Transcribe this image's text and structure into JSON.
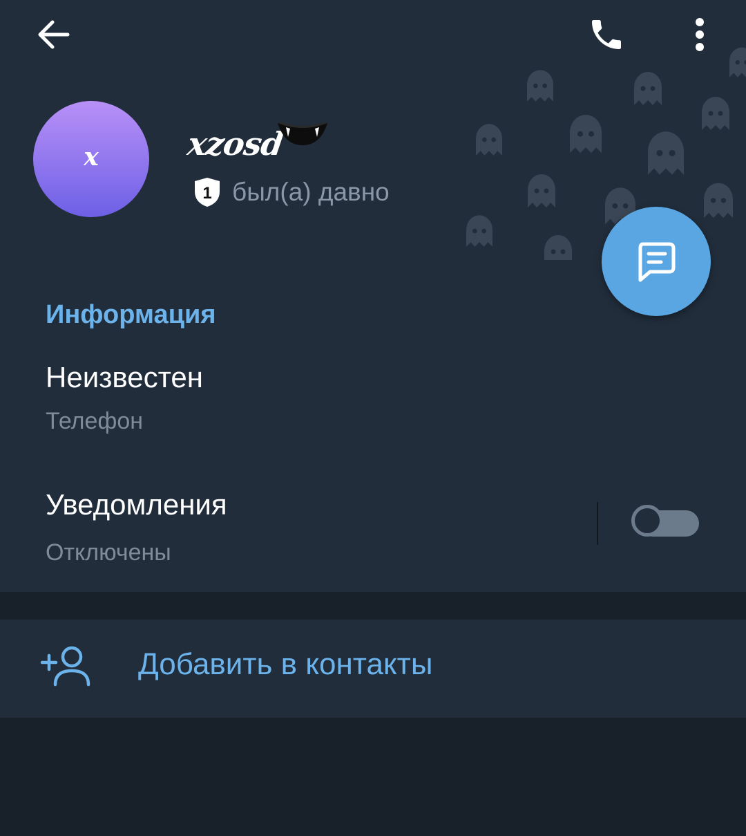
{
  "header": {
    "back_icon": "arrow-left-icon",
    "call_icon": "phone-icon",
    "more_icon": "more-vertical-icon",
    "background_color": "#212d3b"
  },
  "profile": {
    "avatar_letter": "x",
    "avatar_gradient": [
      "#b890f7",
      "#6d60e6"
    ],
    "name": "xzosd",
    "name_emoji": "fangs",
    "status_badge": "1",
    "status": "был(а) давно"
  },
  "fab": {
    "icon": "message-icon",
    "color": "#5aa6e2"
  },
  "info": {
    "title": "Информация",
    "phone_value": "Неизвестен",
    "phone_label": "Телефон",
    "notifications_title": "Уведомления",
    "notifications_status": "Отключены",
    "notifications_enabled": false
  },
  "actions": {
    "add_contact_label": "Добавить в контакты",
    "add_contact_icon": "add-user-icon"
  },
  "colors": {
    "accent": "#6bb3ea",
    "background": "#18202a",
    "surface": "#212d3b"
  }
}
